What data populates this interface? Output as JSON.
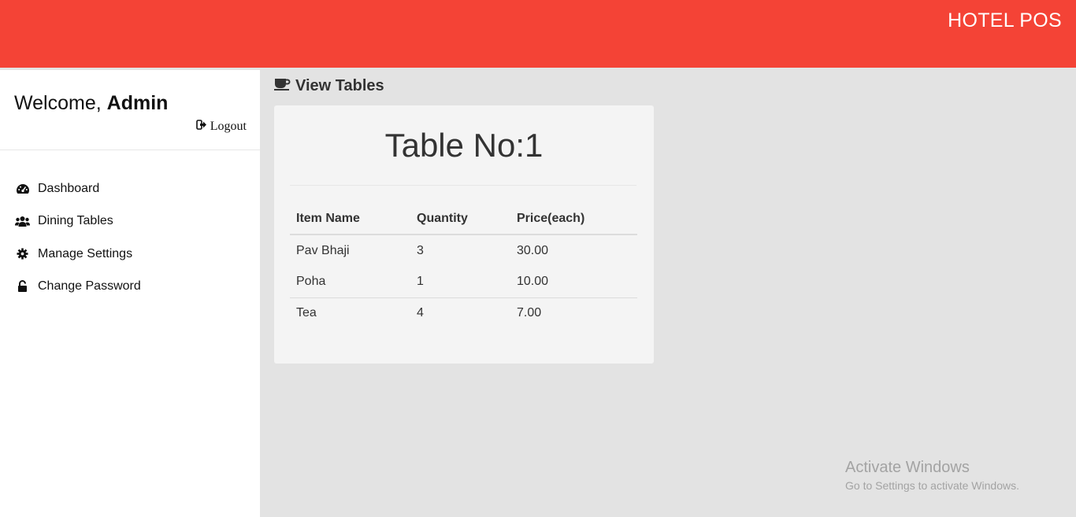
{
  "header": {
    "brand": "HOTEL POS",
    "accent_color": "#f44336"
  },
  "sidebar": {
    "welcome_prefix": "Welcome,",
    "username": "Admin",
    "logout_label": "Logout",
    "logout_icon": "sign-out-icon",
    "items": [
      {
        "label": "Dashboard",
        "icon": "dashboard-icon"
      },
      {
        "label": "Dining Tables",
        "icon": "users-icon"
      },
      {
        "label": "Manage Settings",
        "icon": "gear-icon"
      },
      {
        "label": "Change Password",
        "icon": "unlock-icon"
      }
    ]
  },
  "main": {
    "heading": "View Tables",
    "heading_icon": "coffee-cup-icon",
    "card": {
      "title": "Table No:1",
      "columns": [
        "Item Name",
        "Quantity",
        "Price(each)"
      ],
      "rows": [
        {
          "item": "Pav Bhaji",
          "qty": "3",
          "price": "30.00"
        },
        {
          "item": "Poha",
          "qty": "1",
          "price": "10.00"
        },
        {
          "item": "Tea",
          "qty": "4",
          "price": "7.00"
        }
      ]
    }
  },
  "watermark": {
    "title": "Activate Windows",
    "subtitle": "Go to Settings to activate Windows."
  }
}
